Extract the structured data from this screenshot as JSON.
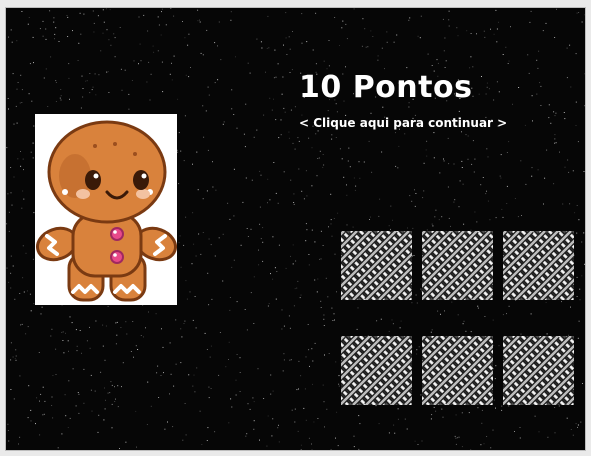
{
  "game": {
    "score_text": "10 Pontos",
    "continue_text": "< Clique aqui para continuar >",
    "character": "gingerbread-man",
    "cards": [
      {
        "state": "face-down"
      },
      {
        "state": "face-down"
      },
      {
        "state": "face-down"
      },
      {
        "state": "face-down"
      },
      {
        "state": "face-down"
      },
      {
        "state": "face-down"
      }
    ]
  },
  "colors": {
    "background": "#060606",
    "text": "#ffffff",
    "cookie": "#d9823c",
    "cookie_dark": "#9c4f1e",
    "icing": "#ffffff",
    "button": "#e84a8a"
  }
}
